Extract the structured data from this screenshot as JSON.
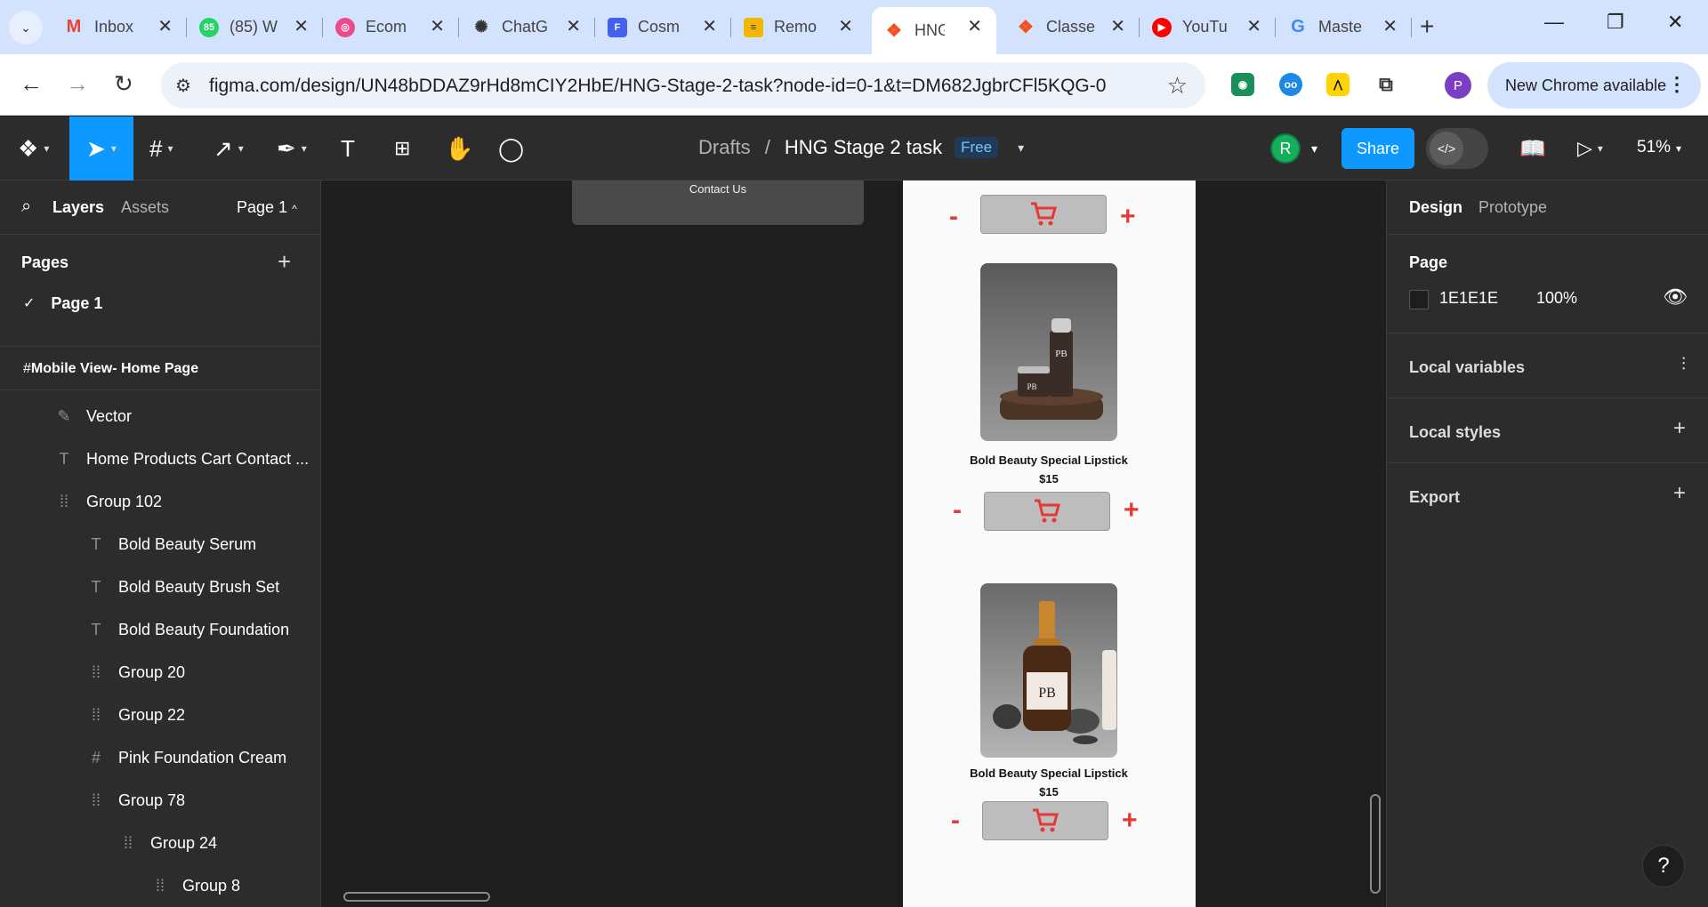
{
  "browser": {
    "tabs": [
      {
        "title": "Inbox",
        "icon": "gmail-icon",
        "color": "#ea4335"
      },
      {
        "title": "(85) W",
        "icon": "whatsapp-icon",
        "color": "#25d366"
      },
      {
        "title": "Ecom",
        "icon": "dribbble-icon",
        "color": "#ea4c89"
      },
      {
        "title": "ChatG",
        "icon": "chatgpt-icon",
        "color": "#333333"
      },
      {
        "title": "Cosm",
        "icon": "form-icon",
        "color": "#4361ee"
      },
      {
        "title": "Remo",
        "icon": "stack-icon",
        "color": "#f2b705"
      },
      {
        "title": "HNG",
        "icon": "figma-icon",
        "color": "#f24e1e"
      },
      {
        "title": "Classe",
        "icon": "figma-icon",
        "color": "#f24e1e"
      },
      {
        "title": "YouTu",
        "icon": "youtube-icon",
        "color": "#ff0000"
      },
      {
        "title": "Maste",
        "icon": "google-icon",
        "color": "#4285f4"
      }
    ],
    "url": "figma.com/design/UN48bDDAZ9rHd8mCIY2HbE/HNG-Stage-2-task?node-id=0-1&t=DM682JgbrCFl5KQG-0",
    "profile_initial": "P",
    "update_label": "New Chrome available"
  },
  "figma": {
    "breadcrumb_project": "Drafts",
    "breadcrumb_sep": "/",
    "file_name": "HNG Stage 2 task",
    "plan_badge": "Free",
    "collaborator_initial": "R",
    "share_label": "Share",
    "zoom": "51%"
  },
  "left_panel": {
    "tab_layers": "Layers",
    "tab_assets": "Assets",
    "page_selector": "Page 1",
    "pages_heading": "Pages",
    "current_page": "Page 1",
    "root_frame": "Mobile View- Home Page",
    "layers": [
      {
        "label": "Vector",
        "type": "vector"
      },
      {
        "label": "Home Products Cart Contact ...",
        "type": "text"
      },
      {
        "label": "Group 102",
        "type": "group"
      },
      {
        "label": "Bold Beauty Serum",
        "type": "text"
      },
      {
        "label": "Bold Beauty Brush Set",
        "type": "text"
      },
      {
        "label": "Bold Beauty Foundation",
        "type": "text"
      },
      {
        "label": "Group 20",
        "type": "group"
      },
      {
        "label": "Group 22",
        "type": "group"
      },
      {
        "label": "Pink Foundation Cream",
        "type": "frame"
      },
      {
        "label": "Group 78",
        "type": "group"
      },
      {
        "label": "Group 24",
        "type": "group"
      },
      {
        "label": "Group 8",
        "type": "group"
      }
    ]
  },
  "canvas": {
    "footer_link": "Contact Us",
    "products": [
      {
        "name": "Bold Beauty Special Lipstick",
        "price": "$15",
        "image": "skincare-jars-on-wood"
      },
      {
        "name": "Bold Beauty Special Lipstick",
        "price": "$15",
        "image": "serum-bottle-on-stones"
      }
    ],
    "minus_label": "-",
    "plus_label": "+",
    "accent_color": "#e53935"
  },
  "right_panel": {
    "tab_design": "Design",
    "tab_prototype": "Prototype",
    "page_heading": "Page",
    "page_color": "1E1E1E",
    "page_opacity": "100%",
    "local_variables": "Local variables",
    "local_styles": "Local styles",
    "export": "Export"
  },
  "help_label": "?"
}
